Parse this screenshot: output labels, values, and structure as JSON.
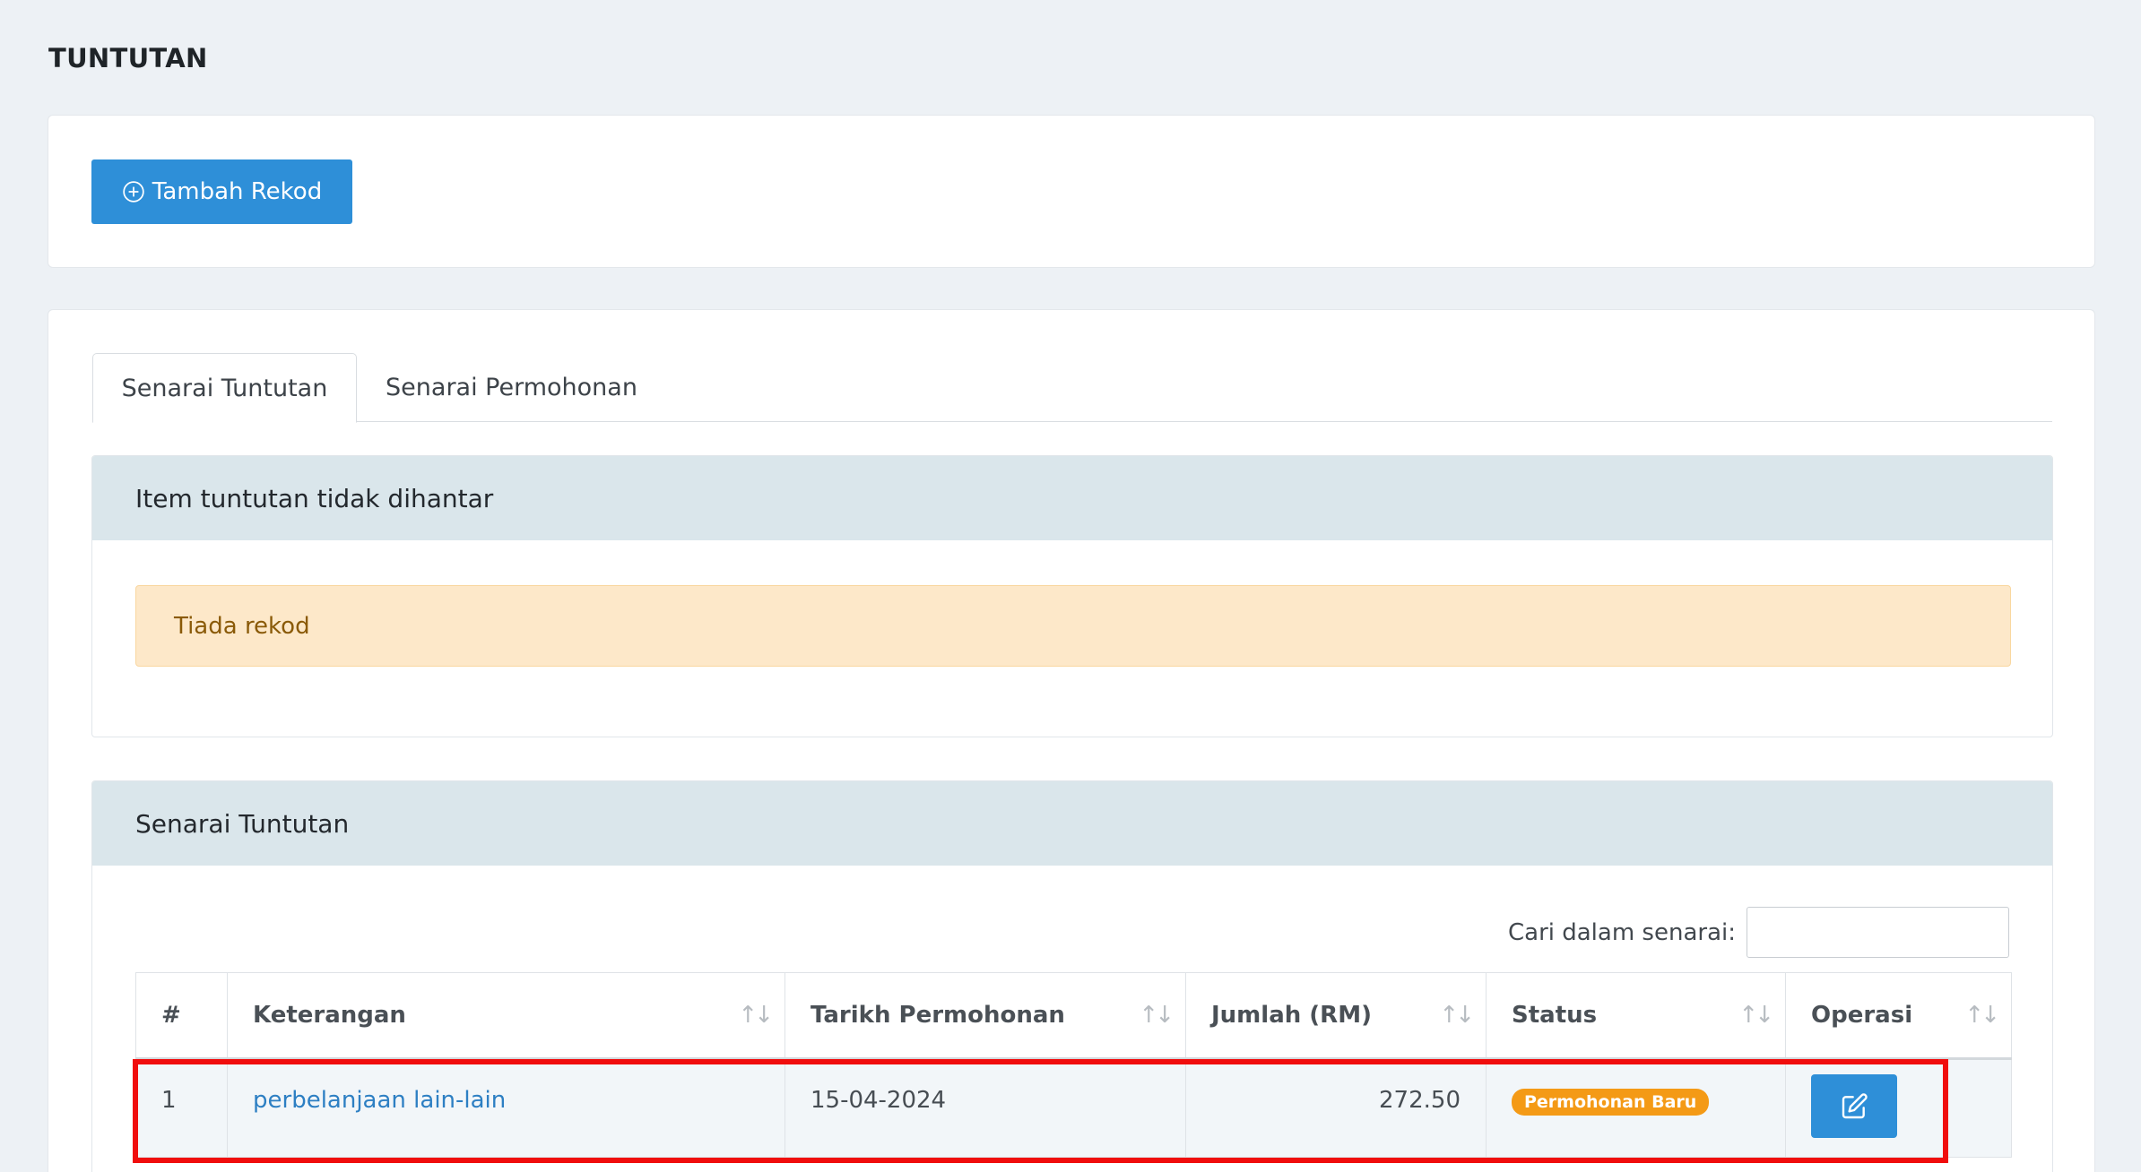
{
  "page": {
    "title": "TUNTUTAN"
  },
  "toolbar": {
    "add_label": "Tambah Rekod",
    "add_icon": "plus-circle-icon"
  },
  "tabs": [
    {
      "label": "Senarai Tuntutan",
      "active": true
    },
    {
      "label": "Senarai Permohonan",
      "active": false
    }
  ],
  "unsent_panel": {
    "title": "Item tuntutan tidak dihantar",
    "alert_text": "Tiada rekod"
  },
  "claims_panel": {
    "title": "Senarai Tuntutan",
    "search_label": "Cari dalam senarai:",
    "search_value": "",
    "columns": [
      "#",
      "Keterangan",
      "Tarikh Permohonan",
      "Jumlah (RM)",
      "Status",
      "Operasi"
    ],
    "rows": [
      {
        "no": "1",
        "description": "perbelanjaan lain-lain",
        "date": "15-04-2024",
        "amount": "272.50",
        "status": "Permohonan Baru",
        "action_icon": "edit-icon"
      }
    ]
  },
  "colors": {
    "primary": "#2e8fd8",
    "badge_warning": "#f49a16",
    "alert_bg": "#fde8c9",
    "panel_header": "#dae6eb",
    "highlight": "#f00d0d"
  }
}
